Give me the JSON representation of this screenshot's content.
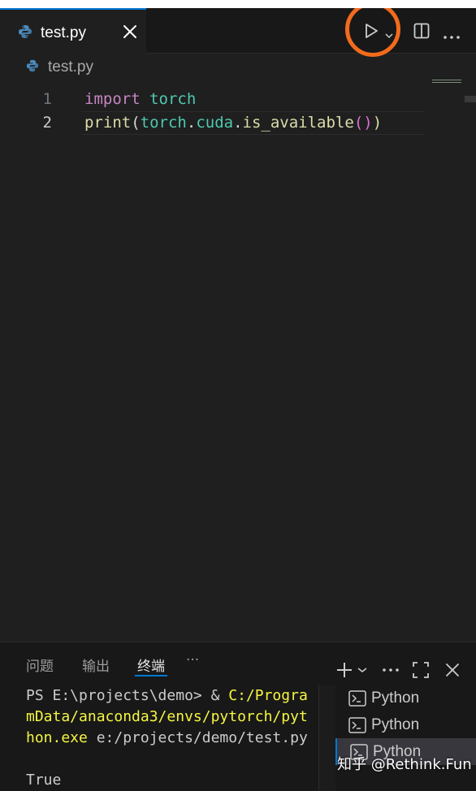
{
  "tab": {
    "label": "test.py"
  },
  "breadcrumb": {
    "file": "test.py"
  },
  "editor": {
    "lines": [
      {
        "number": "1",
        "tokens": [
          "import",
          " ",
          "torch"
        ]
      },
      {
        "number": "2",
        "tokens": [
          "print",
          "(",
          "torch",
          ".",
          "cuda",
          ".",
          "is_available",
          "()",
          ")"
        ]
      }
    ]
  },
  "panel": {
    "tabs": [
      "问题",
      "输出",
      "终端"
    ],
    "more": "···",
    "terminal_lines": [
      {
        "plain": "PS E:\\projects\\demo> & ",
        "highlight": "C:/Progra"
      },
      {
        "plain": "",
        "highlight": "mData/anaconda3/envs/pytorch/pyt"
      },
      {
        "plain": " e:/projects/demo/test.py",
        "highlight": "hon.exe"
      },
      {
        "plain": "",
        "highlight": ""
      },
      {
        "plain": "True",
        "highlight": ""
      }
    ],
    "terminals": [
      "Python",
      "Python",
      "Python"
    ]
  },
  "watermark": "知乎 @Rethink.Fun",
  "colors": {
    "accent": "#0078d4",
    "highlight_ring": "#f26b1d",
    "keyword": "#c586c0",
    "module": "#4ec9b0",
    "function": "#dcdcaa",
    "terminal_path": "#f5f543"
  }
}
